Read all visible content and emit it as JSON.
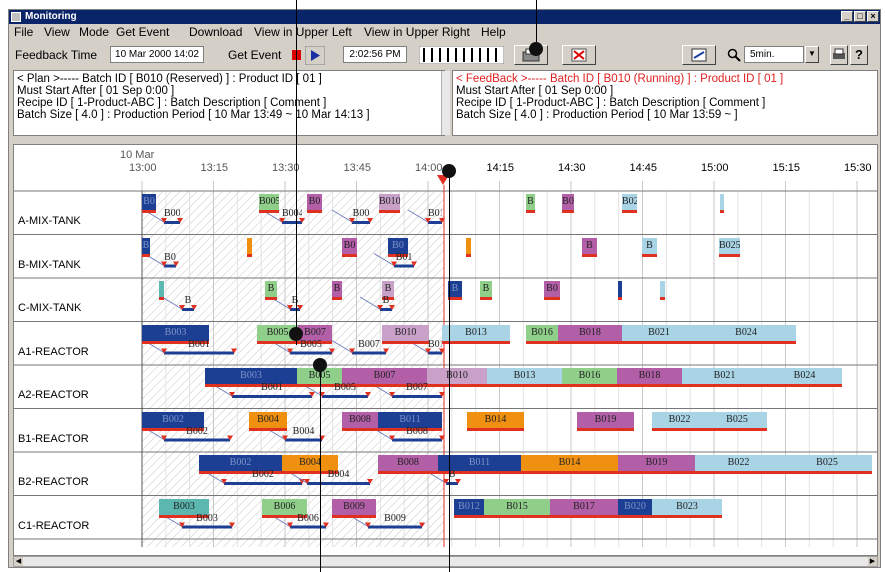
{
  "window": {
    "title": "Monitoring"
  },
  "menu": [
    "File",
    "View",
    "Mode",
    "Get Event",
    "Download",
    "View in Upper Left",
    "View in Upper Right",
    "Help"
  ],
  "toolbar": {
    "feedback_time_label": "Feedback Time",
    "feedback_time_value": "10 Mar 2000 14:02",
    "get_event_label": "Get Event",
    "clock_value": "2:02:56 PM",
    "zoom_value": "5min."
  },
  "plan_panel": {
    "line1": "< Plan >----- Batch ID [ B010 (Reserved) ]  :  Product ID [ 01 ]",
    "line2": "Must Start After [ 01 Sep 0:00 ]",
    "line3": "Recipe ID [ 1-Product-ABC ]  :  Batch Description [ Comment ]",
    "line4": "Batch Size [ 4.0 ]  :  Production Period [ 10 Mar 13:49 ~ 10 Mar 14:13 ]"
  },
  "feedback_panel": {
    "line1": "< FeedBack >----- Batch ID [ B010 (Running) ]  :  Product ID [ 01 ]",
    "line2": "Must Start After [ 01 Sep 0:00 ]",
    "line3": "Recipe ID [ 1-Product-ABC ]  :  Batch Description [ Comment ]",
    "line4": "Batch Size [ 4.0 ]  :  Production Period [ 10 Mar 13:59 ~ ]"
  },
  "timeline": {
    "date_label": "10 Mar",
    "ticks": [
      "13:00",
      "13:15",
      "13:30",
      "13:45",
      "14:00",
      "14:15",
      "14:30",
      "14:45",
      "15:00",
      "15:15",
      "15:30"
    ]
  },
  "resources": [
    "A-MIX-TANK",
    "B-MIX-TANK",
    "C-MIX-TANK",
    "A1-REACTOR",
    "A2-REACTOR",
    "B1-REACTOR",
    "B2-REACTOR",
    "C1-REACTOR"
  ],
  "colors": {
    "navy": "#1c3f94",
    "green": "#8fcf8a",
    "purple": "#b35fa8",
    "lightblue": "#a8d4e6",
    "orange": "#f09010",
    "mauve": "#c8a0c8",
    "red": "#e03020",
    "teal": "#5bb7b0"
  },
  "bars": [
    {
      "row": 0,
      "start": 0,
      "end": 14,
      "color": "navy",
      "label": "B0"
    },
    {
      "row": 0,
      "start": 117,
      "end": 137,
      "color": "green",
      "label": "B005"
    },
    {
      "row": 0,
      "start": 165,
      "end": 180,
      "color": "purple",
      "label": "B0"
    },
    {
      "row": 0,
      "start": 237,
      "end": 258,
      "color": "mauve",
      "label": "B010"
    },
    {
      "row": 0,
      "start": 384,
      "end": 393,
      "color": "green",
      "label": "B"
    },
    {
      "row": 0,
      "start": 420,
      "end": 432,
      "color": "purple",
      "label": "B0"
    },
    {
      "row": 0,
      "start": 480,
      "end": 495,
      "color": "lightblue",
      "label": "B02"
    },
    {
      "row": 0,
      "start": 578,
      "end": 582,
      "color": "lightblue",
      "label": ""
    },
    {
      "row": 1,
      "start": 0,
      "end": 8,
      "color": "navy",
      "label": "B"
    },
    {
      "row": 1,
      "start": 105,
      "end": 110,
      "color": "orange",
      "label": ""
    },
    {
      "row": 1,
      "start": 200,
      "end": 215,
      "color": "purple",
      "label": "B0"
    },
    {
      "row": 1,
      "start": 246,
      "end": 266,
      "color": "navy",
      "label": "B0"
    },
    {
      "row": 1,
      "start": 324,
      "end": 329,
      "color": "orange",
      "label": ""
    },
    {
      "row": 1,
      "start": 440,
      "end": 455,
      "color": "purple",
      "label": "B"
    },
    {
      "row": 1,
      "start": 500,
      "end": 515,
      "color": "lightblue",
      "label": "B"
    },
    {
      "row": 1,
      "start": 577,
      "end": 598,
      "color": "lightblue",
      "label": "B025"
    },
    {
      "row": 2,
      "start": 17,
      "end": 22,
      "color": "teal",
      "label": ""
    },
    {
      "row": 2,
      "start": 123,
      "end": 135,
      "color": "green",
      "label": "B"
    },
    {
      "row": 2,
      "start": 190,
      "end": 200,
      "color": "purple",
      "label": "B"
    },
    {
      "row": 2,
      "start": 240,
      "end": 252,
      "color": "mauve",
      "label": "B"
    },
    {
      "row": 2,
      "start": 306,
      "end": 320,
      "color": "navy",
      "label": "B"
    },
    {
      "row": 2,
      "start": 338,
      "end": 350,
      "color": "green",
      "label": "B"
    },
    {
      "row": 2,
      "start": 402,
      "end": 418,
      "color": "purple",
      "label": "B0"
    },
    {
      "row": 2,
      "start": 476,
      "end": 480,
      "color": "navy",
      "label": ""
    },
    {
      "row": 2,
      "start": 518,
      "end": 523,
      "color": "lightblue",
      "label": ""
    },
    {
      "row": 3,
      "start": 0,
      "end": 67,
      "color": "navy",
      "label": "B003"
    },
    {
      "row": 3,
      "start": 115,
      "end": 156,
      "color": "green",
      "label": "B005"
    },
    {
      "row": 3,
      "start": 156,
      "end": 190,
      "color": "purple",
      "label": "B007"
    },
    {
      "row": 3,
      "start": 240,
      "end": 287,
      "color": "mauve",
      "label": "B010"
    },
    {
      "row": 3,
      "start": 300,
      "end": 368,
      "color": "lightblue",
      "label": "B013"
    },
    {
      "row": 3,
      "start": 384,
      "end": 416,
      "color": "green",
      "label": "B016"
    },
    {
      "row": 3,
      "start": 416,
      "end": 480,
      "color": "purple",
      "label": "B018"
    },
    {
      "row": 3,
      "start": 480,
      "end": 554,
      "color": "lightblue",
      "label": "B021"
    },
    {
      "row": 3,
      "start": 554,
      "end": 654,
      "color": "lightblue",
      "label": "B024"
    },
    {
      "row": 4,
      "start": 63,
      "end": 155,
      "color": "navy",
      "label": "B003"
    },
    {
      "row": 4,
      "start": 155,
      "end": 200,
      "color": "green",
      "label": "B005"
    },
    {
      "row": 4,
      "start": 200,
      "end": 285,
      "color": "purple",
      "label": "B007"
    },
    {
      "row": 4,
      "start": 285,
      "end": 345,
      "color": "mauve",
      "label": "B010"
    },
    {
      "row": 4,
      "start": 345,
      "end": 420,
      "color": "lightblue",
      "label": "B013"
    },
    {
      "row": 4,
      "start": 420,
      "end": 475,
      "color": "green",
      "label": "B016"
    },
    {
      "row": 4,
      "start": 475,
      "end": 540,
      "color": "purple",
      "label": "B018"
    },
    {
      "row": 4,
      "start": 540,
      "end": 625,
      "color": "lightblue",
      "label": "B021"
    },
    {
      "row": 4,
      "start": 625,
      "end": 700,
      "color": "lightblue",
      "label": "B024"
    },
    {
      "row": 5,
      "start": 0,
      "end": 62,
      "color": "navy",
      "label": "B002"
    },
    {
      "row": 5,
      "start": 107,
      "end": 145,
      "color": "orange",
      "label": "B004"
    },
    {
      "row": 5,
      "start": 200,
      "end": 236,
      "color": "purple",
      "label": "B008"
    },
    {
      "row": 5,
      "start": 236,
      "end": 300,
      "color": "navy",
      "label": "B011"
    },
    {
      "row": 5,
      "start": 325,
      "end": 382,
      "color": "orange",
      "label": "B014"
    },
    {
      "row": 5,
      "start": 435,
      "end": 492,
      "color": "purple",
      "label": "B019"
    },
    {
      "row": 5,
      "start": 510,
      "end": 565,
      "color": "lightblue",
      "label": "B022"
    },
    {
      "row": 5,
      "start": 565,
      "end": 625,
      "color": "lightblue",
      "label": "B025"
    },
    {
      "row": 6,
      "start": 57,
      "end": 140,
      "color": "navy",
      "label": "B002"
    },
    {
      "row": 6,
      "start": 140,
      "end": 196,
      "color": "orange",
      "label": "B004"
    },
    {
      "row": 6,
      "start": 236,
      "end": 296,
      "color": "purple",
      "label": "B008"
    },
    {
      "row": 6,
      "start": 296,
      "end": 379,
      "color": "navy",
      "label": "B011"
    },
    {
      "row": 6,
      "start": 379,
      "end": 476,
      "color": "orange",
      "label": "B014"
    },
    {
      "row": 6,
      "start": 476,
      "end": 553,
      "color": "purple",
      "label": "B019"
    },
    {
      "row": 6,
      "start": 553,
      "end": 640,
      "color": "lightblue",
      "label": "B022"
    },
    {
      "row": 6,
      "start": 640,
      "end": 730,
      "color": "lightblue",
      "label": "B025"
    },
    {
      "row": 7,
      "start": 17,
      "end": 67,
      "color": "teal",
      "label": "B003"
    },
    {
      "row": 7,
      "start": 120,
      "end": 165,
      "color": "green",
      "label": "B006"
    },
    {
      "row": 7,
      "start": 190,
      "end": 234,
      "color": "purple",
      "label": "B009"
    },
    {
      "row": 7,
      "start": 312,
      "end": 342,
      "color": "navy",
      "label": "B012"
    },
    {
      "row": 7,
      "start": 342,
      "end": 408,
      "color": "green",
      "label": "B015"
    },
    {
      "row": 7,
      "start": 408,
      "end": 476,
      "color": "purple",
      "label": "B017"
    },
    {
      "row": 7,
      "start": 476,
      "end": 510,
      "color": "navy",
      "label": "B020"
    },
    {
      "row": 7,
      "start": 510,
      "end": 580,
      "color": "lightblue",
      "label": "B023"
    }
  ],
  "plan_bars": [
    {
      "row": 0,
      "start": 22,
      "end": 38,
      "label": "B00"
    },
    {
      "row": 0,
      "start": 140,
      "end": 160,
      "label": "B004"
    },
    {
      "row": 0,
      "start": 210,
      "end": 228,
      "label": "B00"
    },
    {
      "row": 0,
      "start": 286,
      "end": 300,
      "label": "B01"
    },
    {
      "row": 1,
      "start": 22,
      "end": 34,
      "label": "B0"
    },
    {
      "row": 1,
      "start": 252,
      "end": 272,
      "label": "B01"
    },
    {
      "row": 2,
      "start": 40,
      "end": 52,
      "label": "B"
    },
    {
      "row": 2,
      "start": 148,
      "end": 158,
      "label": "B"
    },
    {
      "row": 2,
      "start": 238,
      "end": 250,
      "label": "B"
    },
    {
      "row": 3,
      "start": 22,
      "end": 92,
      "label": "B001"
    },
    {
      "row": 3,
      "start": 148,
      "end": 190,
      "label": "B005"
    },
    {
      "row": 3,
      "start": 210,
      "end": 244,
      "label": "B007"
    },
    {
      "row": 3,
      "start": 286,
      "end": 300,
      "label": "B01"
    },
    {
      "row": 4,
      "start": 90,
      "end": 170,
      "label": "B001"
    },
    {
      "row": 4,
      "start": 180,
      "end": 226,
      "label": "B005"
    },
    {
      "row": 4,
      "start": 250,
      "end": 300,
      "label": "B007"
    },
    {
      "row": 5,
      "start": 22,
      "end": 88,
      "label": "B002"
    },
    {
      "row": 5,
      "start": 143,
      "end": 180,
      "label": "B004"
    },
    {
      "row": 5,
      "start": 250,
      "end": 300,
      "label": "B008"
    },
    {
      "row": 6,
      "start": 82,
      "end": 160,
      "label": "B002"
    },
    {
      "row": 6,
      "start": 165,
      "end": 228,
      "label": "B004"
    },
    {
      "row": 6,
      "start": 304,
      "end": 316,
      "label": "B"
    },
    {
      "row": 7,
      "start": 40,
      "end": 90,
      "label": "B003"
    },
    {
      "row": 7,
      "start": 148,
      "end": 184,
      "label": "B006"
    },
    {
      "row": 7,
      "start": 226,
      "end": 280,
      "label": "B009"
    }
  ]
}
